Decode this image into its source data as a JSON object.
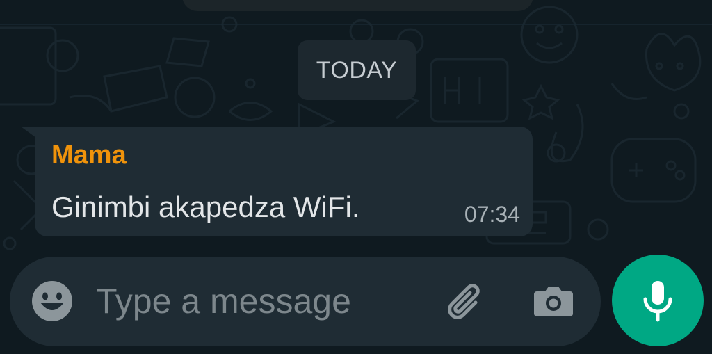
{
  "date_separator": {
    "label": "TODAY"
  },
  "message": {
    "sender": "Mama",
    "text": "Ginimbi akapedza WiFi.",
    "time": "07:34"
  },
  "composer": {
    "placeholder": "Type a message",
    "value": "",
    "emoji_icon": "emoji-icon",
    "attach_icon": "paperclip-icon",
    "camera_icon": "camera-icon"
  },
  "mic_button": {
    "icon": "microphone-icon"
  },
  "colors": {
    "background": "#0f1a20",
    "bubble": "#1f2c34",
    "sender_name": "#f0930b",
    "accent": "#00a884",
    "message_text": "#e3e6e8",
    "meta_text": "#a9b2b7"
  }
}
